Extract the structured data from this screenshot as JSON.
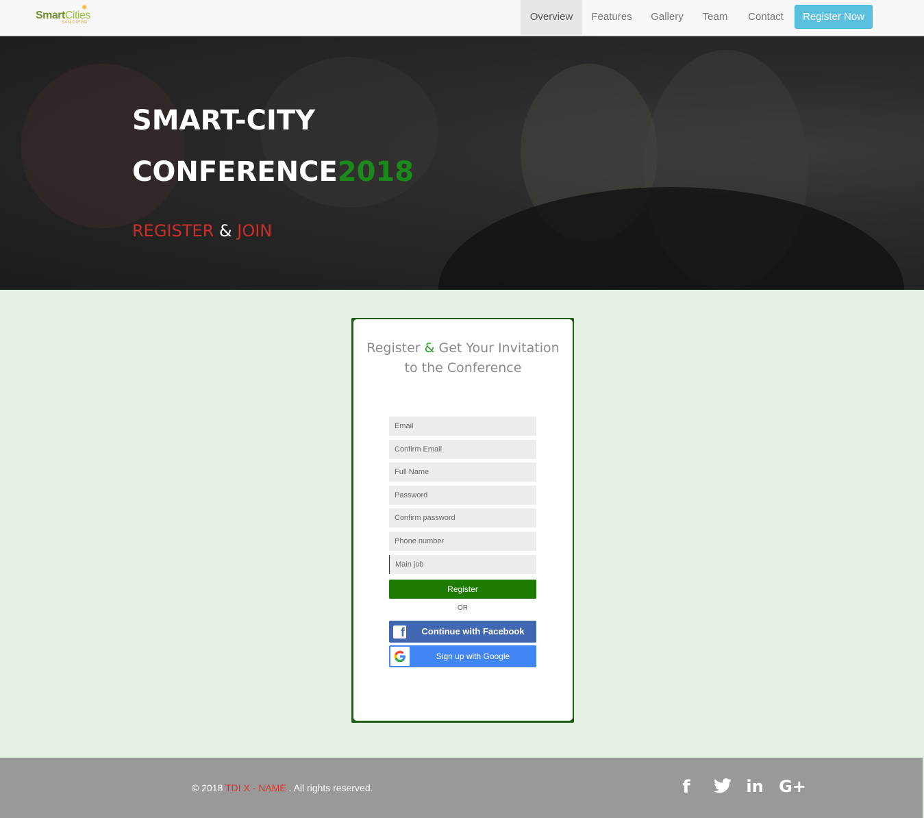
{
  "navbar": {
    "logo_main_a": "Smart",
    "logo_main_b": "Cities",
    "logo_sub": "SAN DIEGO",
    "items": [
      {
        "label": "Overview",
        "active": true
      },
      {
        "label": "Features",
        "active": false
      },
      {
        "label": "Gallery",
        "active": false
      },
      {
        "label": "Team",
        "active": false
      },
      {
        "label": "Contact",
        "active": false
      }
    ],
    "register_now": "Register Now"
  },
  "hero": {
    "title_line1": "SMART-CITY",
    "title_line2": "CONFERENCE",
    "year": "2018",
    "register": "REGISTER",
    "amp": "&",
    "join": "JOIN"
  },
  "form": {
    "title_a": "Register ",
    "title_amp": "&",
    "title_b": " Get Your Invitation",
    "title_c": "to the Conference",
    "fields": [
      {
        "placeholder": "Email"
      },
      {
        "placeholder": "Confirm Email"
      },
      {
        "placeholder": "Full Name"
      },
      {
        "placeholder": "Password"
      },
      {
        "placeholder": "Confirm password"
      },
      {
        "placeholder": "Phone number"
      },
      {
        "placeholder": "Main job"
      }
    ],
    "register_button": "Register",
    "or": "OR",
    "facebook_button": "Continue with Facebook",
    "google_button": "Sign up with Google"
  },
  "footer": {
    "copyright_prefix": "© 2018 ",
    "brand": "TDI X - NAME",
    "copyright_suffix": " . All rights reserved.",
    "social": [
      "facebook-icon",
      "twitter-icon",
      "linkedin-icon",
      "google-plus-icon"
    ]
  },
  "colors": {
    "accent_green": "#1e7c04",
    "info_blue": "#5bc0de",
    "facebook_blue": "#4267b2",
    "google_blue": "#4285f4",
    "background_mint": "#e3f1e2",
    "footer_gray": "#999999",
    "hero_red": "#c9302c"
  }
}
